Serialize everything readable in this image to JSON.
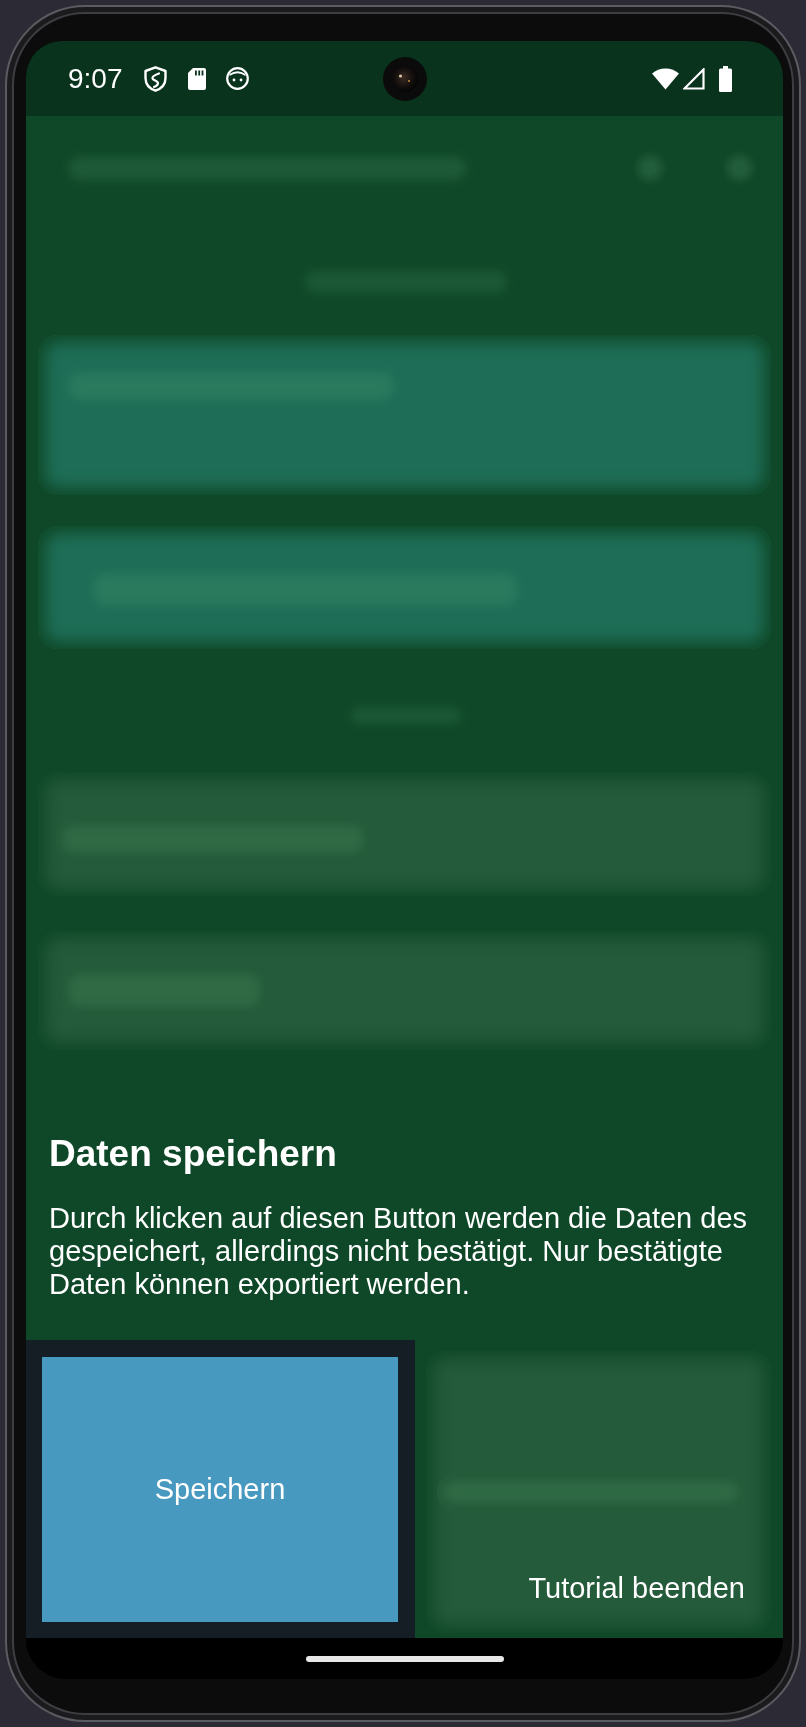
{
  "status_bar": {
    "time": "9:07"
  },
  "tutorial": {
    "title": "Daten speichern",
    "text": "Durch klicken auf diesen Button werden die Daten des gespeichert, allerdings nicht bestätigt. Nur bestätigte Daten können exportiert werden."
  },
  "highlighted_button": {
    "label": "Speichern"
  },
  "end_tutorial_button": {
    "label": "Tutorial beenden"
  }
}
